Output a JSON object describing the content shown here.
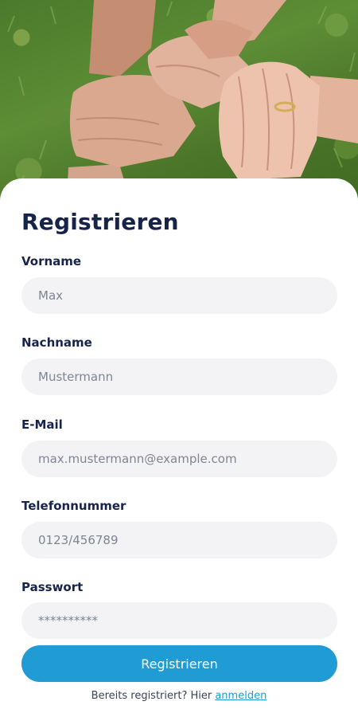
{
  "hero": {
    "icon": "stacked-hands-photo"
  },
  "form": {
    "title": "Registrieren",
    "fields": [
      {
        "label": "Vorname",
        "placeholder": "Max",
        "value": ""
      },
      {
        "label": "Nachname",
        "placeholder": "Mustermann",
        "value": ""
      },
      {
        "label": "E-Mail",
        "placeholder": "max.mustermann@example.com",
        "value": ""
      },
      {
        "label": "Telefonnummer",
        "placeholder": "0123/456789",
        "value": ""
      },
      {
        "label": "Passwort",
        "placeholder": "**********",
        "value": ""
      }
    ],
    "submit_label": "Registrieren",
    "footer_text": "Bereits registriert? Hier ",
    "footer_link": "anmelden"
  },
  "colors": {
    "primary": "#219bd4",
    "heading": "#17244a",
    "input_bg": "#f3f3f5",
    "placeholder": "#7d8596"
  }
}
